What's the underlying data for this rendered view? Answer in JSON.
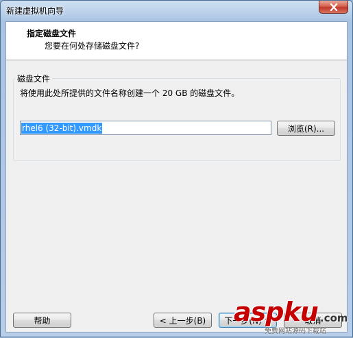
{
  "window": {
    "title": "新建虚拟机向导"
  },
  "header": {
    "title": "指定磁盘文件",
    "subtitle": "您要在何处存储磁盘文件?"
  },
  "disk_group": {
    "label": "磁盘文件",
    "description": "将使用此处所提供的文件名称创建一个 20 GB 的磁盘文件。",
    "file_value": "rhel6 (32-bit).vmdk",
    "browse_label": "浏览(R)..."
  },
  "footer": {
    "help_label": "帮助",
    "back_label": "< 上一步(B)",
    "next_label": "下一步(N) >",
    "cancel_label": "取消"
  },
  "watermark": {
    "text": "aspku",
    "dotcom": ".com",
    "sub": "免费网站源码下载站"
  },
  "colors": {
    "title_frame": "#a9c3e3",
    "close_button": "#c0392b",
    "selection": "#3399ff",
    "watermark": "#c40000"
  }
}
